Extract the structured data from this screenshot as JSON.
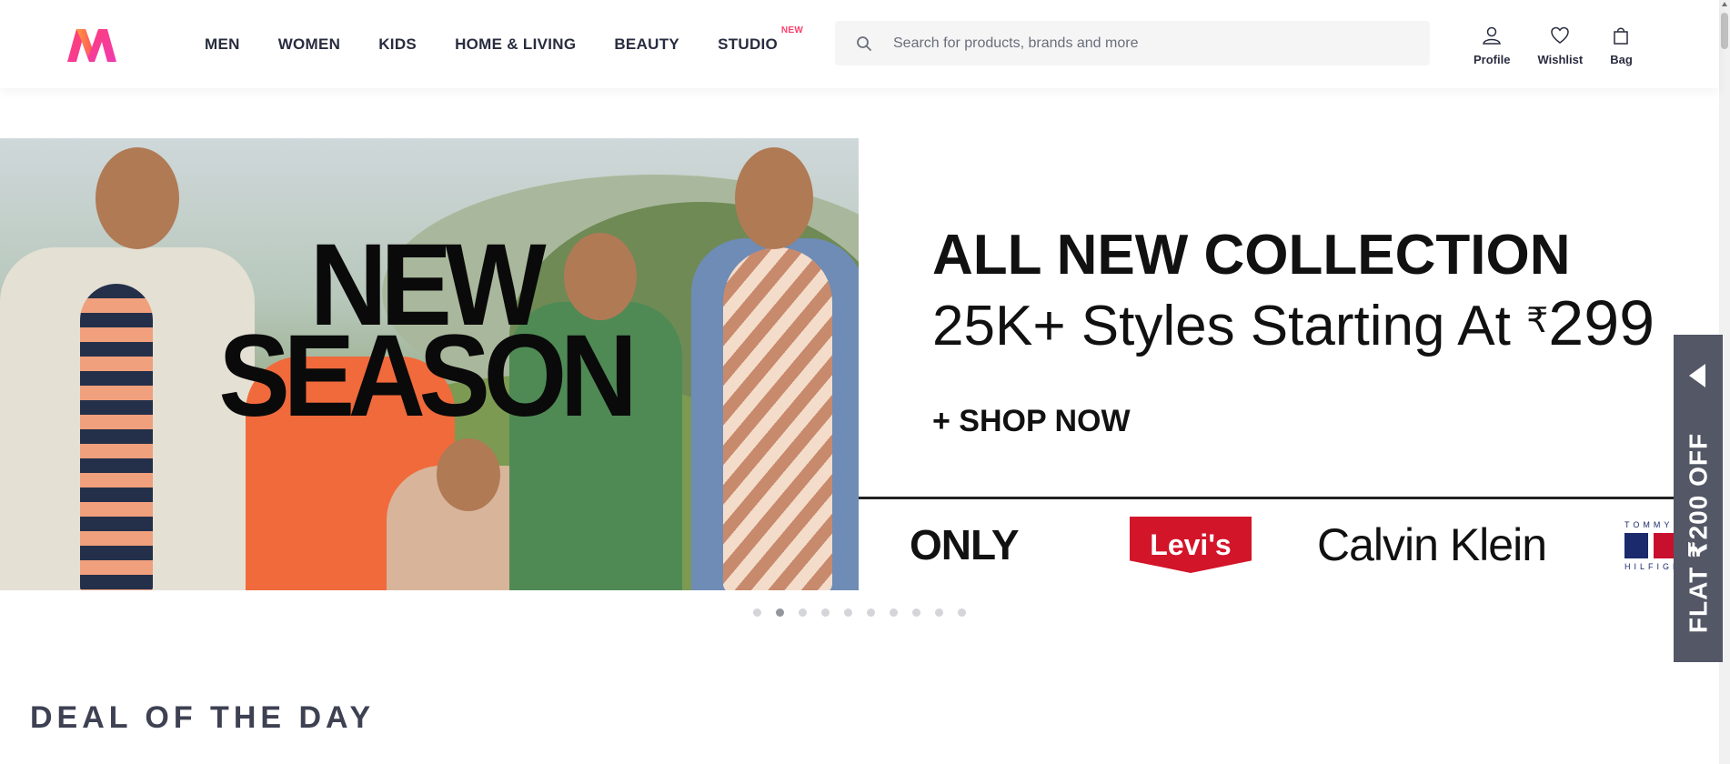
{
  "header": {
    "nav": [
      {
        "label": "MEN"
      },
      {
        "label": "WOMEN"
      },
      {
        "label": "KIDS"
      },
      {
        "label": "HOME & LIVING"
      },
      {
        "label": "BEAUTY"
      },
      {
        "label": "STUDIO",
        "badge": "NEW"
      }
    ],
    "search": {
      "placeholder": "Search for products, brands and more",
      "icon": "search-icon"
    },
    "actions": [
      {
        "label": "Profile",
        "icon": "profile-icon"
      },
      {
        "label": "Wishlist",
        "icon": "heart-icon"
      },
      {
        "label": "Bag",
        "icon": "bag-icon"
      }
    ]
  },
  "banner": {
    "image_text_line1": "NEW",
    "image_text_line2": "SEASON",
    "headline_line1": "ALL NEW COLLECTION",
    "headline_line2": "25K+ Styles Starting At",
    "currency": "₹",
    "price": "299",
    "cta": "+ SHOP NOW",
    "brands": [
      "ONLY",
      "Levi's",
      "Calvin Klein",
      "TOMMY HILFIGER"
    ],
    "slide_count": 10,
    "active_slide": 2
  },
  "offer_tab": {
    "label": "FLAT ₹200 OFF"
  },
  "section": {
    "title": "DEAL OF THE DAY"
  },
  "colors": {
    "brand_pink": "#ff3f6c",
    "text_dark": "#282c3f",
    "offer_bg": "#535766",
    "levis_red": "#d3152a"
  }
}
